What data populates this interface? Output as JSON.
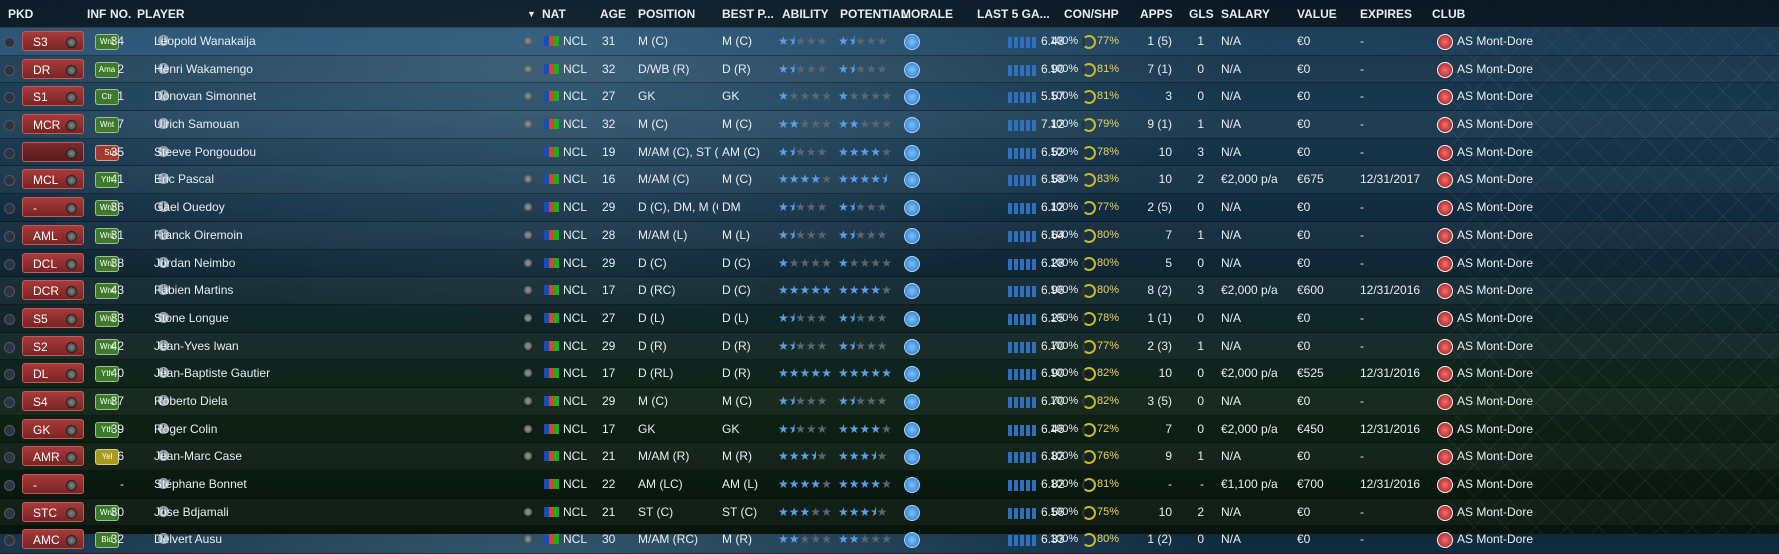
{
  "headers": {
    "pkd": "PKD",
    "inf": "INF",
    "no": "NO.",
    "player": "PLAYER",
    "nat": "NAT",
    "age": "AGE",
    "position": "POSITION",
    "best_pos": "BEST P...",
    "ability": "ABILITY",
    "potential": "POTENTIAL",
    "morale": "MORALE",
    "last5": "LAST 5 GA...",
    "con_shp": "CON/SHP",
    "apps": "APPS",
    "gls": "GLS",
    "salary": "SALARY",
    "value": "VALUE",
    "expires": "EXPIRES",
    "club": "CLUB"
  },
  "colors": {
    "accent": "#5aa0e8",
    "position_badge": "#a83a3a",
    "status_green": "#3d7a2a",
    "status_red": "#a33a2e",
    "status_yellow": "#a89a1a"
  },
  "players": [
    {
      "pkd": "S3",
      "inf": "Wnt",
      "infc": "g",
      "no": "34",
      "name": "Leopold Wanakaija",
      "dot": true,
      "nat": "NCL",
      "age": "31",
      "position": "M (C)",
      "best": "M (C)",
      "ability": 1.5,
      "potential": 1.5,
      "last5": "6.48",
      "con": "100%",
      "shp": "77%",
      "apps": "1 (5)",
      "gls": "1",
      "salary": "N/A",
      "value": "€0",
      "expires": "-",
      "club": "AS Mont-Dore"
    },
    {
      "pkd": "DR",
      "inf": "Ama",
      "infc": "g",
      "no": "2",
      "name": "Henri Wakamengo",
      "dot": true,
      "nat": "NCL",
      "age": "32",
      "position": "D/WB (R)",
      "best": "D (R)",
      "ability": 1.5,
      "potential": 1.5,
      "last5": "6.90",
      "con": "100%",
      "shp": "81%",
      "apps": "7 (1)",
      "gls": "0",
      "salary": "N/A",
      "value": "€0",
      "expires": "-",
      "club": "AS Mont-Dore"
    },
    {
      "pkd": "S1",
      "inf": "Ctr",
      "infc": "g",
      "no": "1",
      "name": "Donovan Simonnet",
      "dot": true,
      "nat": "NCL",
      "age": "27",
      "position": "GK",
      "best": "GK",
      "ability": 1,
      "potential": 1,
      "last5": "5.57",
      "con": "100%",
      "shp": "81%",
      "apps": "3",
      "gls": "0",
      "salary": "N/A",
      "value": "€0",
      "expires": "-",
      "club": "AS Mont-Dore"
    },
    {
      "pkd": "MCR",
      "inf": "Wnt",
      "infc": "g",
      "no": "7",
      "name": "Ulrich Samouan",
      "dot": true,
      "nat": "NCL",
      "age": "32",
      "position": "M (C)",
      "best": "M (C)",
      "ability": 2,
      "potential": 2,
      "last5": "7.12",
      "con": "100%",
      "shp": "79%",
      "apps": "9 (1)",
      "gls": "1",
      "salary": "N/A",
      "value": "€0",
      "expires": "-",
      "club": "AS Mont-Dore"
    },
    {
      "pkd": "",
      "inf": "Sus",
      "infc": "r",
      "no": "35",
      "name": "Steeve Pongoudou",
      "dot": false,
      "nat": "NCL",
      "age": "19",
      "position": "M/AM (C), ST (...",
      "best": "AM (C)",
      "ability": 1.5,
      "potential": 4,
      "last5": "6.52",
      "con": "100%",
      "shp": "78%",
      "apps": "10",
      "gls": "3",
      "salary": "N/A",
      "value": "€0",
      "expires": "-",
      "club": "AS Mont-Dore"
    },
    {
      "pkd": "MCL",
      "inf": "Yth",
      "infc": "g",
      "no": "41",
      "name": "Eric Pascal",
      "dot": true,
      "nat": "NCL",
      "age": "16",
      "position": "M/AM (C)",
      "best": "M (C)",
      "ability": 4,
      "potential": 4.5,
      "last5": "6.58",
      "con": "100%",
      "shp": "83%",
      "apps": "10",
      "gls": "2",
      "salary": "€2,000 p/a",
      "value": "€675",
      "expires": "12/31/2017",
      "club": "AS Mont-Dore"
    },
    {
      "pkd": "-",
      "inf": "Wnt",
      "infc": "g",
      "no": "36",
      "name": "Gael Ouedoy",
      "dot": true,
      "nat": "NCL",
      "age": "29",
      "position": "D (C), DM, M (C)",
      "best": "DM",
      "ability": 1.5,
      "potential": 1.5,
      "last5": "6.12",
      "con": "100%",
      "shp": "77%",
      "apps": "2 (5)",
      "gls": "0",
      "salary": "N/A",
      "value": "€0",
      "expires": "-",
      "club": "AS Mont-Dore"
    },
    {
      "pkd": "AML",
      "inf": "Wnt",
      "infc": "g",
      "no": "31",
      "name": "Franck Oiremoin",
      "dot": true,
      "nat": "NCL",
      "age": "28",
      "position": "M/AM (L)",
      "best": "M (L)",
      "ability": 1.5,
      "potential": 1.5,
      "last5": "6.64",
      "con": "100%",
      "shp": "80%",
      "apps": "7",
      "gls": "1",
      "salary": "N/A",
      "value": "€0",
      "expires": "-",
      "club": "AS Mont-Dore"
    },
    {
      "pkd": "DCL",
      "inf": "Wnt",
      "infc": "g",
      "no": "38",
      "name": "Jordan Neimbo",
      "dot": true,
      "nat": "NCL",
      "age": "29",
      "position": "D (C)",
      "best": "D (C)",
      "ability": 1,
      "potential": 1,
      "last5": "6.28",
      "con": "100%",
      "shp": "80%",
      "apps": "5",
      "gls": "0",
      "salary": "N/A",
      "value": "€0",
      "expires": "-",
      "club": "AS Mont-Dore"
    },
    {
      "pkd": "DCR",
      "inf": "Wnt",
      "infc": "g",
      "no": "43",
      "name": "Fabien Martins",
      "dot": true,
      "nat": "NCL",
      "age": "17",
      "position": "D (RC)",
      "best": "D (C)",
      "ability": 5,
      "potential": 4,
      "last5": "6.96",
      "con": "100%",
      "shp": "80%",
      "apps": "8 (2)",
      "gls": "3",
      "salary": "€2,000 p/a",
      "value": "€600",
      "expires": "12/31/2016",
      "club": "AS Mont-Dore"
    },
    {
      "pkd": "S5",
      "inf": "Wnt",
      "infc": "g",
      "no": "33",
      "name": "Stone Longue",
      "dot": true,
      "nat": "NCL",
      "age": "27",
      "position": "D (L)",
      "best": "D (L)",
      "ability": 1.5,
      "potential": 1.5,
      "last5": "6.25",
      "con": "100%",
      "shp": "78%",
      "apps": "1 (1)",
      "gls": "0",
      "salary": "N/A",
      "value": "€0",
      "expires": "-",
      "club": "AS Mont-Dore"
    },
    {
      "pkd": "S2",
      "inf": "Wnt",
      "infc": "g",
      "no": "42",
      "name": "Jean-Yves Iwan",
      "dot": true,
      "nat": "NCL",
      "age": "29",
      "position": "D (R)",
      "best": "D (R)",
      "ability": 1.5,
      "potential": 1.5,
      "last5": "6.70",
      "con": "100%",
      "shp": "77%",
      "apps": "2 (3)",
      "gls": "1",
      "salary": "N/A",
      "value": "€0",
      "expires": "-",
      "club": "AS Mont-Dore"
    },
    {
      "pkd": "DL",
      "inf": "Yth",
      "infc": "g",
      "no": "40",
      "name": "Jean-Baptiste Gautier",
      "dot": true,
      "nat": "NCL",
      "age": "17",
      "position": "D (RL)",
      "best": "D (R)",
      "ability": 5,
      "potential": 5,
      "last5": "6.90",
      "con": "100%",
      "shp": "82%",
      "apps": "10",
      "gls": "0",
      "salary": "€2,000 p/a",
      "value": "€525",
      "expires": "12/31/2016",
      "club": "AS Mont-Dore"
    },
    {
      "pkd": "S4",
      "inf": "Wnt",
      "infc": "g",
      "no": "37",
      "name": "Roberto Diela",
      "dot": true,
      "nat": "NCL",
      "age": "29",
      "position": "M (C)",
      "best": "M (C)",
      "ability": 1.5,
      "potential": 1.5,
      "last5": "6.70",
      "con": "100%",
      "shp": "82%",
      "apps": "3 (5)",
      "gls": "0",
      "salary": "N/A",
      "value": "€0",
      "expires": "-",
      "club": "AS Mont-Dore"
    },
    {
      "pkd": "GK",
      "inf": "Yth",
      "infc": "g",
      "no": "39",
      "name": "Roger Colin",
      "dot": true,
      "nat": "NCL",
      "age": "17",
      "position": "GK",
      "best": "GK",
      "ability": 1.5,
      "potential": 4,
      "last5": "6.46",
      "con": "100%",
      "shp": "72%",
      "apps": "7",
      "gls": "0",
      "salary": "€2,000 p/a",
      "value": "€450",
      "expires": "12/31/2016",
      "club": "AS Mont-Dore"
    },
    {
      "pkd": "AMR",
      "inf": "Yel",
      "infc": "y",
      "no": "6",
      "name": "Jean-Marc Case",
      "dot": true,
      "nat": "NCL",
      "age": "21",
      "position": "M/AM (R)",
      "best": "M (R)",
      "ability": 3.5,
      "potential": 3.5,
      "last5": "6.82",
      "con": "100%",
      "shp": "76%",
      "apps": "9",
      "gls": "1",
      "salary": "N/A",
      "value": "€0",
      "expires": "-",
      "club": "AS Mont-Dore"
    },
    {
      "pkd": "-",
      "inf": "",
      "infc": "",
      "no": "-",
      "name": "Stéphane Bonnet",
      "dot": false,
      "nat": "NCL",
      "age": "22",
      "position": "AM (LC)",
      "best": "AM (L)",
      "ability": 4,
      "potential": 4,
      "last5": "6.82",
      "con": "100%",
      "shp": "81%",
      "apps": "-",
      "gls": "-",
      "salary": "€1,100 p/a",
      "value": "€700",
      "expires": "12/31/2016",
      "club": "AS Mont-Dore"
    },
    {
      "pkd": "STC",
      "inf": "Wnt",
      "infc": "g",
      "no": "30",
      "name": "Jose Bdjamali",
      "dot": true,
      "nat": "NCL",
      "age": "21",
      "position": "ST (C)",
      "best": "ST (C)",
      "ability": 3,
      "potential": 3.5,
      "last5": "6.56",
      "con": "100%",
      "shp": "75%",
      "apps": "10",
      "gls": "2",
      "salary": "N/A",
      "value": "€0",
      "expires": "-",
      "club": "AS Mont-Dore"
    },
    {
      "pkd": "AMC",
      "inf": "Bid",
      "infc": "g",
      "no": "32",
      "name": "Delvert Ausu",
      "dot": true,
      "nat": "NCL",
      "age": "30",
      "position": "M/AM (RC)",
      "best": "M (R)",
      "ability": 2,
      "potential": 2,
      "last5": "6.33",
      "con": "100%",
      "shp": "80%",
      "apps": "1 (2)",
      "gls": "0",
      "salary": "N/A",
      "value": "€0",
      "expires": "-",
      "club": "AS Mont-Dore"
    }
  ]
}
